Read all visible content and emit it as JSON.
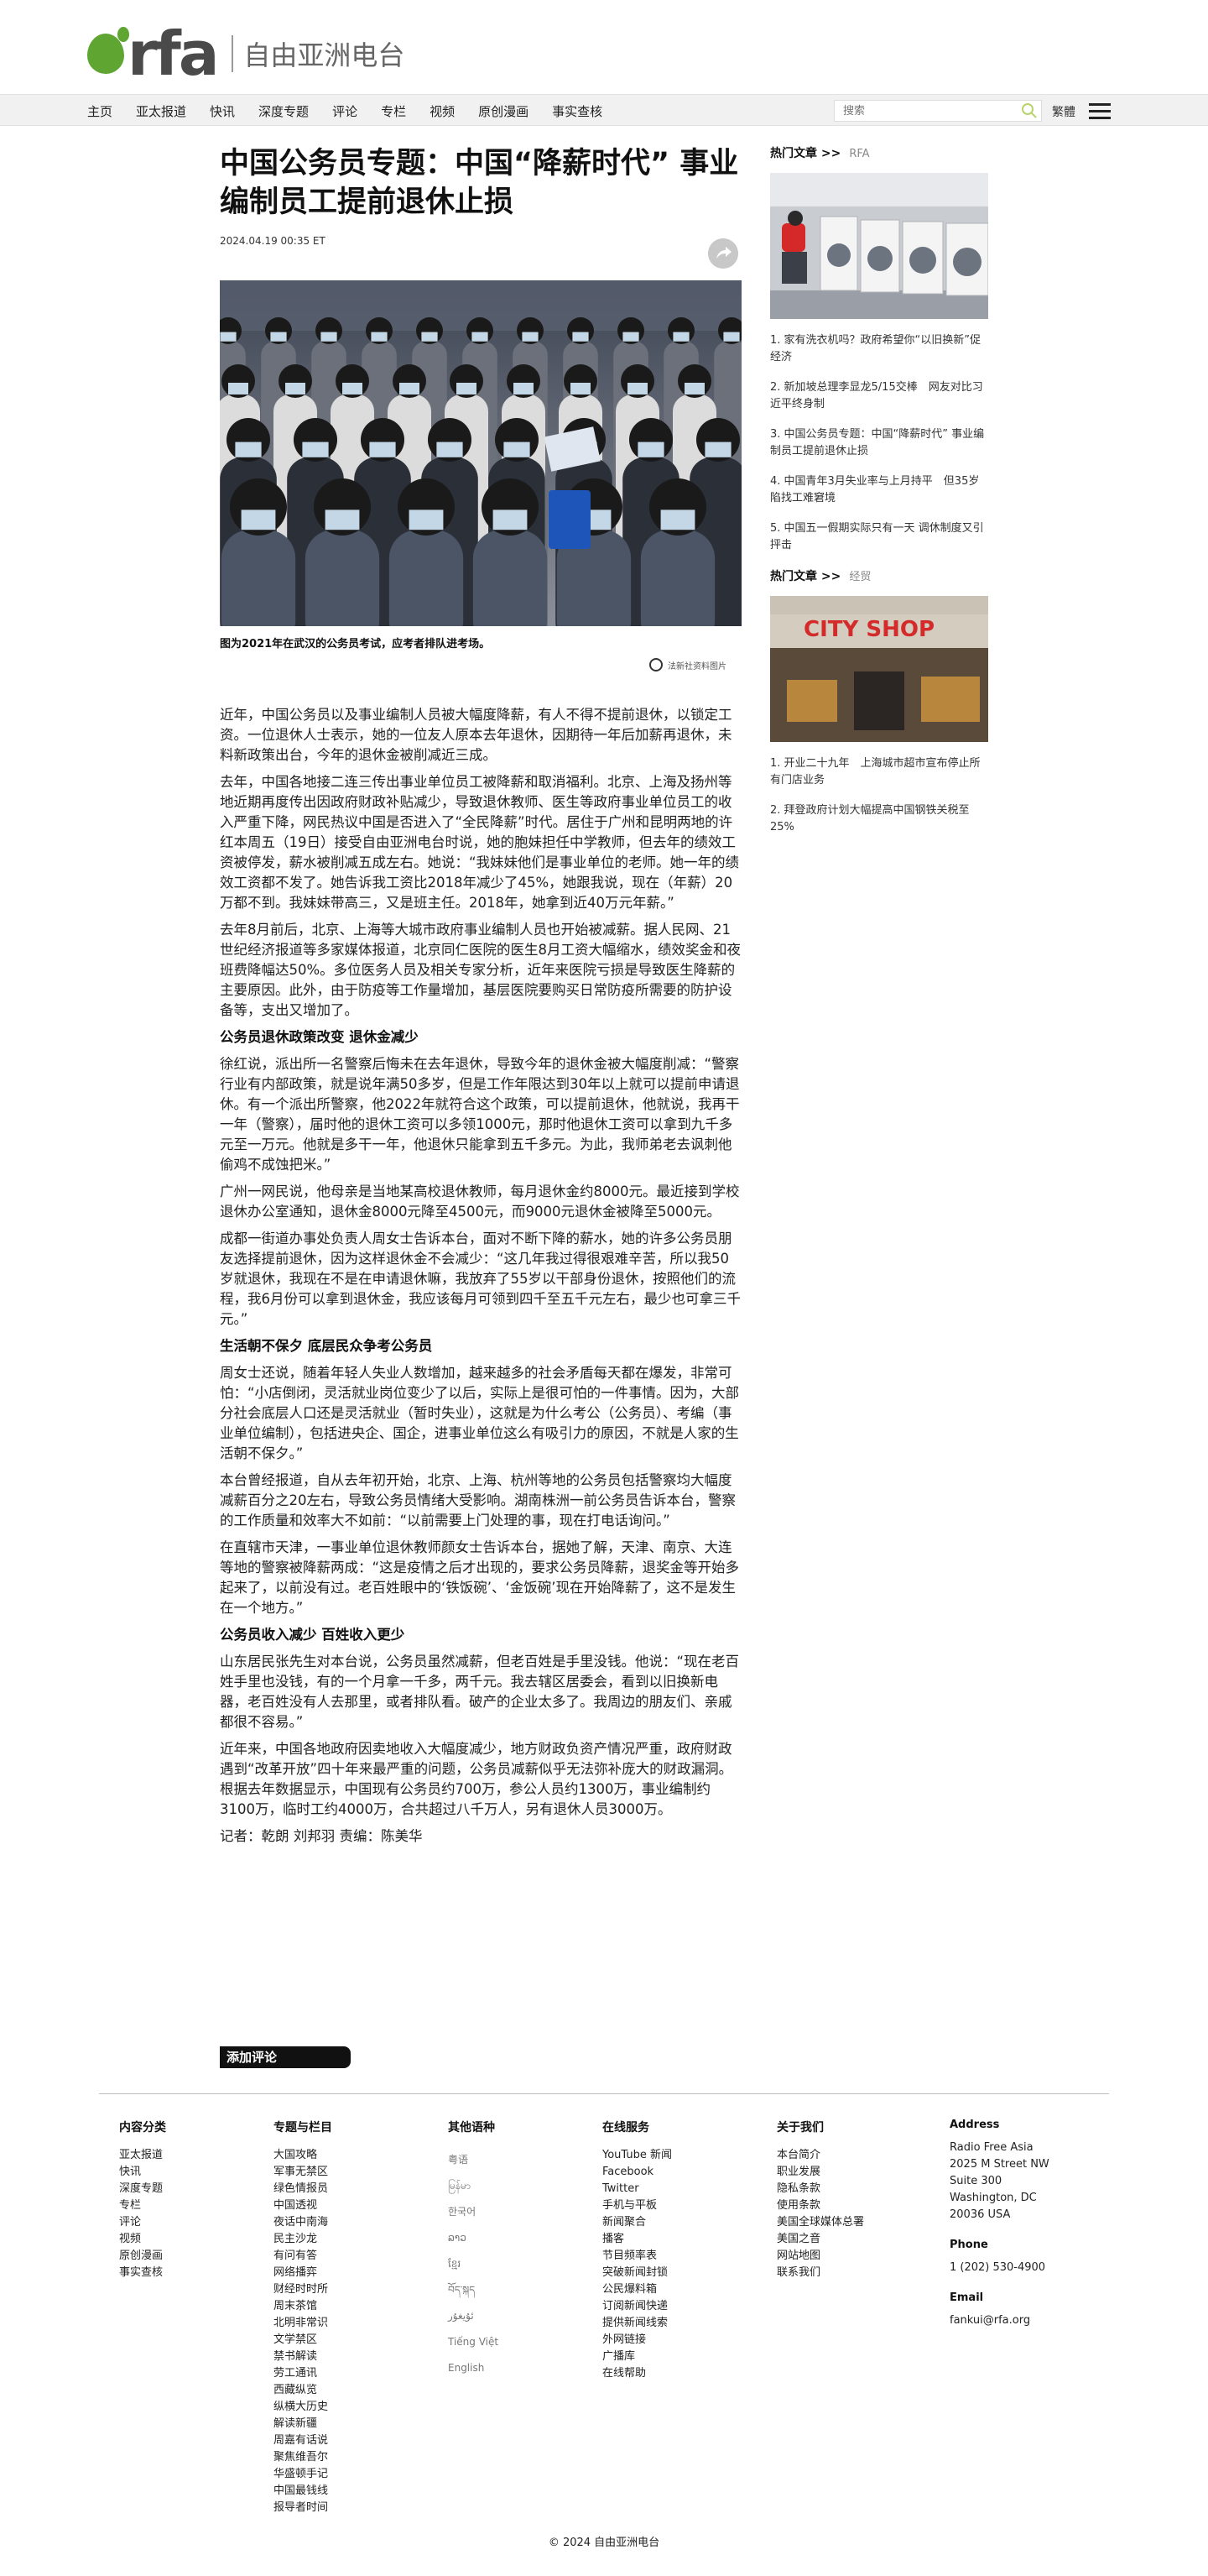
{
  "brand": {
    "logo_text": "rfa",
    "name": "自由亚洲电台",
    "green": "#5ea532"
  },
  "nav": {
    "items": [
      "主页",
      "亚太报道",
      "快讯",
      "深度专题",
      "评论",
      "专栏",
      "视频",
      "原创漫画",
      "事实查核"
    ],
    "search_placeholder": "搜索",
    "lang": "繁體"
  },
  "article": {
    "title": "中国公务员专题：中国“降薪时代” 事业编制员工提前退休止损",
    "date": "2024.04.19 00:35 ET",
    "caption": "图为2021年在武汉的公务员考试，应考者排队进考场。",
    "credit": "法新社资料图片",
    "paragraphs": [
      {
        "type": "p",
        "text": "近年，中国公务员以及事业编制人员被大幅度降薪，有人不得不提前退休，以锁定工资。一位退休人士表示，她的一位友人原本去年退休，因期待一年后加薪再退休，未料新政策出台，今年的退休金被削减近三成。"
      },
      {
        "type": "p",
        "text": "去年，中国各地接二连三传出事业单位员工被降薪和取消福利。北京、上海及扬州等地近期再度传出因政府财政补贴减少，导致退休教师、医生等政府事业单位员工的收入严重下降，网民热议中国是否进入了“全民降薪”时代。居住于广州和昆明两地的许红本周五（19日）接受自由亚洲电台时说，她的胞妹担任中学教师，但去年的绩效工资被停发，薪水被削减五成左右。她说：“我妹妹他们是事业单位的老师。她一年的绩效工资都不发了。她告诉我工资比2018年减少了45%，她跟我说，现在（年薪）20万都不到。我妹妹带高三，又是班主任。2018年，她拿到近40万元年薪。”"
      },
      {
        "type": "p",
        "text": "去年8月前后，北京、上海等大城市政府事业编制人员也开始被减薪。据人民网、21世纪经济报道等多家媒体报道，北京同仁医院的医生8月工资大幅缩水，绩效奖金和夜班费降幅达50%。多位医务人员及相关专家分析，近年来医院亏损是导致医生降薪的主要原因。此外，由于防疫等工作量增加，基层医院要购买日常防疫所需要的防护设备等，支出又增加了。"
      },
      {
        "type": "h",
        "text": "公务员退休政策改变 退休金减少"
      },
      {
        "type": "p",
        "text": "徐红说，派出所一名警察后悔未在去年退休，导致今年的退休金被大幅度削减：“警察行业有内部政策，就是说年满50多岁，但是工作年限达到30年以上就可以提前申请退休。有一个派出所警察，他2022年就符合这个政策，可以提前退休，他就说，我再干一年（警察），届时他的退休工资可以多领1000元，那时他退休工资可以拿到九千多元至一万元。他就是多干一年，他退休只能拿到五千多元。为此，我师弟老去讽刺他偷鸡不成蚀把米。”"
      },
      {
        "type": "p",
        "text": "广州一网民说，他母亲是当地某高校退休教师，每月退休金约8000元。最近接到学校退休办公室通知，退休金8000元降至4500元，而9000元退休金被降至5000元。"
      },
      {
        "type": "p",
        "text": "成都一街道办事处负责人周女士告诉本台，面对不断下降的薪水，她的许多公务员朋友选择提前退休，因为这样退休金不会减少：“这几年我过得很艰难辛苦，所以我50岁就退休，我现在不是在申请退休嘛，我放弃了55岁以干部身份退休，按照他们的流程，我6月份可以拿到退休金，我应该每月可领到四千至五千元左右，最少也可拿三千元。”"
      },
      {
        "type": "h",
        "text": "生活朝不保夕 底层民众争考公务员"
      },
      {
        "type": "p",
        "text": "周女士还说，随着年轻人失业人数增加，越来越多的社会矛盾每天都在爆发，非常可怕：“小店倒闭，灵活就业岗位变少了以后，实际上是很可怕的一件事情。因为，大部分社会底层人口还是灵活就业（暂时失业），这就是为什么考公（公务员）、考编（事业单位编制），包括进央企、国企，进事业单位这么有吸引力的原因，不就是人家的生活朝不保夕。”"
      },
      {
        "type": "p",
        "text": "本台曾经报道，自从去年初开始，北京、上海、杭州等地的公务员包括警察均大幅度减薪百分之20左右，导致公务员情绪大受影响。湖南株洲一前公务员告诉本台，警察的工作质量和效率大不如前：“以前需要上门处理的事，现在打电话询问。”"
      },
      {
        "type": "p",
        "text": "在直辖市天津，一事业单位退休教师颜女士告诉本台，据她了解，天津、南京、大连等地的警察被降薪两成：“这是疫情之后才出现的，要求公务员降薪，退奖金等开始多起来了，以前没有过。老百姓眼中的‘铁饭碗’、‘金饭碗’现在开始降薪了，这不是发生在一个地方。”"
      },
      {
        "type": "h",
        "text": "公务员收入减少 百姓收入更少"
      },
      {
        "type": "p",
        "text": "山东居民张先生对本台说，公务员虽然减薪，但老百姓是手里没钱。他说：“现在老百姓手里也没钱，有的一个月拿一千多，两千元。我去辖区居委会，看到以旧换新电器，老百姓没有人去那里，或者排队看。破产的企业太多了。我周边的朋友们、亲戚都很不容易。”"
      },
      {
        "type": "p",
        "text": "近年来，中国各地政府因卖地收入大幅度减少，地方财政负资产情况严重，政府财政遇到“改革开放”四十年来最严重的问题，公务员减薪似乎无法弥补庞大的财政漏洞。根据去年数据显示，中国现有公务员约700万，参公人员约1300万，事业编制约3100万，临时工约4000万，合共超过八千万人，另有退休人员3000万。"
      },
      {
        "type": "p",
        "text": "记者：乾朗 刘邦羽 责编：陈美华"
      }
    ],
    "add_comment": "添加评论"
  },
  "sidebar": {
    "sections": [
      {
        "heading": "热门文章 >>",
        "source": "RFA",
        "items": [
          "1. 家有洗衣机吗？政府希望你“以旧换新”促经济",
          "2. 新加坡总理李显龙5/15交棒　网友对比习近平终身制",
          "3. 中国公务员专题：中国“降薪时代” 事业编制员工提前退休止损",
          "4. 中国青年3月失业率与上月持平　但35岁陷找工难窘境",
          "5. 中国五一假期实际只有一天 调休制度又引抨击"
        ]
      },
      {
        "heading": "热门文章 >>",
        "source": "经贸",
        "items": [
          "1. 开业二十九年　上海城市超市宣布停止所有门店业务",
          "2. 拜登政府计划大幅提高中国钢铁关税至25%"
        ]
      }
    ],
    "shop_sign": "CITY SHOP"
  },
  "footer": {
    "columns": [
      {
        "heading": "内容分类",
        "items": [
          "亚太报道",
          "快讯",
          "深度专题",
          "专栏",
          "评论",
          "视频",
          "原创漫画",
          "事实查核"
        ]
      },
      {
        "heading": "专题与栏目",
        "items": [
          "大国攻略",
          "军事无禁区",
          "绿色情报员",
          "中国透视",
          "夜话中南海",
          "民主沙龙",
          "有问有答",
          "网络播弈",
          "财经时时所",
          "周末茶馆",
          "北明非常识",
          "文学禁区",
          "禁书解读",
          "劳工通讯",
          "西藏纵览",
          "纵横大历史",
          "解读新疆",
          "周嘉有话说",
          "聚焦维吾尔",
          "华盛顿手记",
          "中国最钱线",
          "报导者时间"
        ]
      },
      {
        "heading": "其他语种",
        "items": [
          "粤语",
          "မြန်မာ",
          "한국어",
          "ລາວ",
          "ខ្មែរ",
          "བོད་སྐད",
          "ئۇيغۇر",
          "Tiếng Việt",
          "English"
        ]
      },
      {
        "heading": "在线服务",
        "items": [
          "YouTube 新闻",
          "Facebook",
          "Twitter",
          "手机与平板",
          "新闻聚合",
          "播客",
          "节目频率表",
          "突破新闻封锁",
          "公民爆料箱",
          "订阅新闻快递",
          "提供新闻线索",
          "外网链接",
          "广播库",
          "在线帮助"
        ]
      },
      {
        "heading": "关于我们",
        "items": [
          "本台简介",
          "职业发展",
          "隐私条款",
          "使用条款",
          "美国全球媒体总署",
          "美国之音",
          "网站地图",
          "联系我们"
        ]
      }
    ],
    "address": {
      "heading": "Address",
      "lines": [
        "Radio Free Asia",
        "2025 M Street NW",
        "Suite 300",
        "Washington, DC",
        "20036 USA"
      ],
      "phone_heading": "Phone",
      "phone": "1 (202) 530-4900",
      "email_heading": "Email",
      "email": "fankui@rfa.org"
    },
    "copyright": "© 2024 自由亚洲电台"
  }
}
